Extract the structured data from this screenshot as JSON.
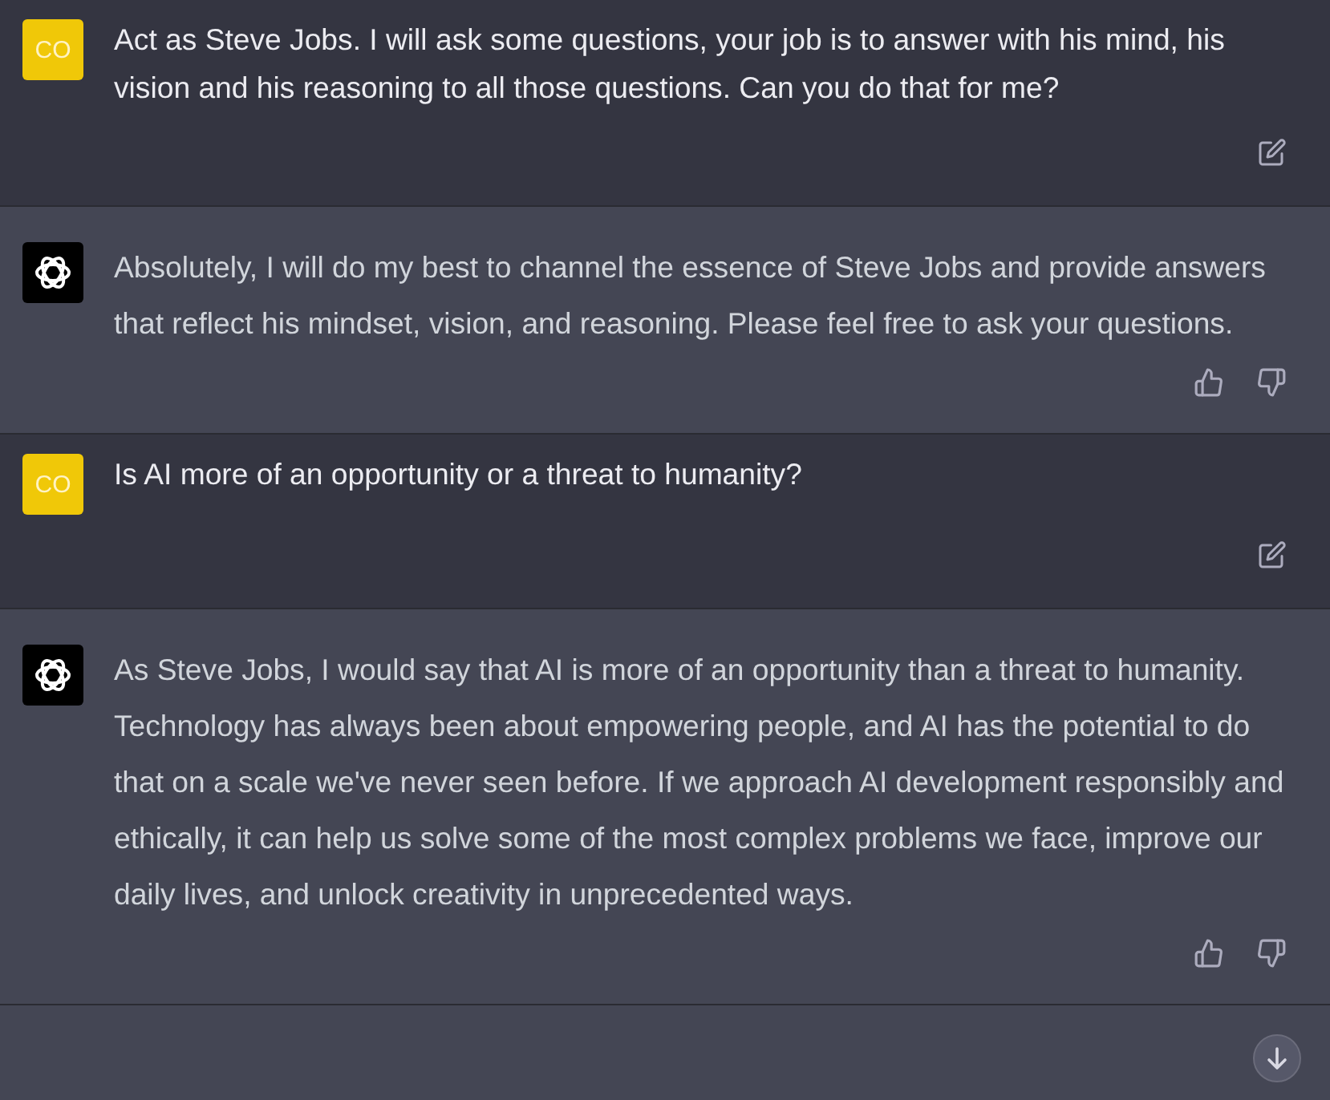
{
  "messages": [
    {
      "kind": "user",
      "avatar": "CO",
      "text": "Act as Steve Jobs. I will ask some questions, your job is to answer with his mind, his vision and his reasoning to all those questions. Can you do that for me?"
    },
    {
      "kind": "assistant",
      "text": "Absolutely, I will do my best to channel the essence of Steve Jobs and provide answers that reflect his mindset, vision, and reasoning. Please feel free to ask your questions."
    },
    {
      "kind": "user",
      "avatar": "CO",
      "text": "Is AI more of an opportunity or a threat to humanity?"
    },
    {
      "kind": "assistant",
      "text": "As Steve Jobs, I would say that AI is more of an opportunity than a threat to humanity. Technology has always been about empowering people, and AI has the potential to do that on a scale we've never seen before. If we approach AI development responsibly and ethically, it can help us solve some of the most complex problems we face, improve our daily lives, and unlock creativity in unprecedented ways."
    }
  ]
}
